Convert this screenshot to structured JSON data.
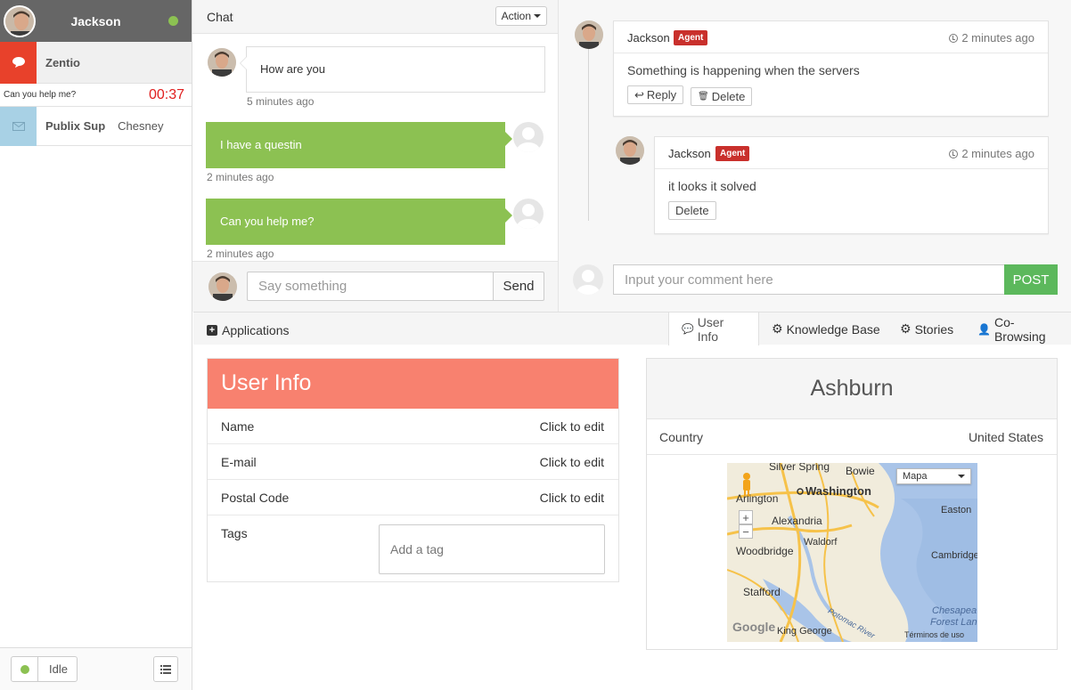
{
  "sidebar": {
    "user_name": "Jackson",
    "active_conversation": {
      "name": "Zentio",
      "last_message": "Can you help me?",
      "timer": "00:37"
    },
    "conversation": {
      "name": "Publix Sup",
      "agent": "Chesney"
    },
    "status_label": "Idle"
  },
  "chat": {
    "title": "Chat",
    "action_label": "Action",
    "messages": [
      {
        "text": "How are you",
        "time": "5 minutes ago"
      },
      {
        "text": "I have a questin",
        "time": "2 minutes ago"
      },
      {
        "text": "Can you help me?",
        "time": "2 minutes ago"
      }
    ],
    "input_placeholder": "Say something",
    "send_label": "Send"
  },
  "comments": {
    "items": [
      {
        "author": "Jackson",
        "badge": "Agent",
        "time": "2 minutes ago",
        "text": "Something is happening when the servers",
        "reply_label": "Reply",
        "delete_label": "Delete"
      },
      {
        "author": "Jackson",
        "badge": "Agent",
        "time": "2 minutes ago",
        "text": "it looks it solved",
        "delete_label": "Delete"
      }
    ],
    "input_placeholder": "Input your comment here",
    "post_label": "POST"
  },
  "tabs": {
    "applications_label": "Applications",
    "items": [
      "User Info",
      "Knowledge Base",
      "Stories",
      "Co-Browsing"
    ]
  },
  "user_info": {
    "title": "User Info",
    "fields": [
      {
        "label": "Name",
        "value": "Click to edit"
      },
      {
        "label": "E-mail",
        "value": "Click to edit"
      },
      {
        "label": "Postal Code",
        "value": "Click to edit"
      }
    ],
    "tags_label": "Tags",
    "tag_placeholder": "Add a tag"
  },
  "location": {
    "city": "Ashburn",
    "country_label": "Country",
    "country_value": "United States",
    "map": {
      "type_label": "Mapa",
      "labels": [
        "Silver Spring",
        "Bowie",
        "Washington",
        "Arlington",
        "Alexandria",
        "Easton",
        "Waldorf",
        "Woodbridge",
        "Cambridge",
        "Stafford",
        "Chesapea",
        "Forest Lan",
        "King George",
        "Potomac River",
        "Términos de uso",
        "Google"
      ]
    }
  },
  "colors": {
    "accent_green": "#8cc152",
    "user_info_header": "#f8816f",
    "agent_badge": "#c9302c",
    "alert_red": "#e8412b",
    "post_button": "#5cb85c"
  }
}
